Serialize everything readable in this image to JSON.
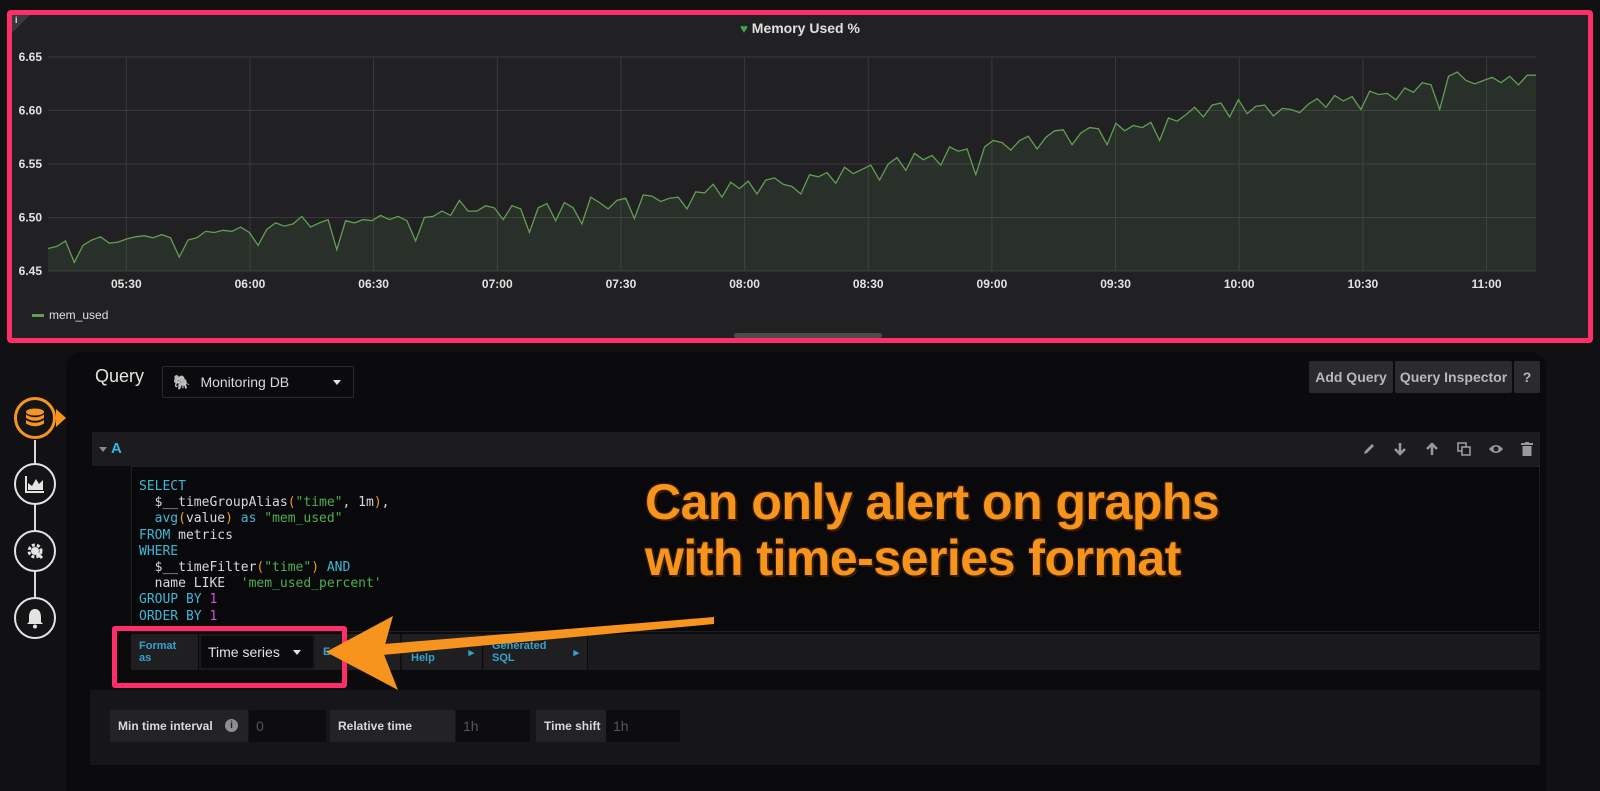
{
  "panel": {
    "title": "Memory Used %",
    "info_icon": "i",
    "legend_label": "mem_used",
    "series_color": "#629e51"
  },
  "chart_data": {
    "type": "area",
    "title": "Memory Used %",
    "xlabel": "",
    "ylabel": "",
    "ylim": [
      6.45,
      6.65
    ],
    "yticks": [
      "6.45",
      "6.50",
      "6.55",
      "6.60",
      "6.65"
    ],
    "xticks": [
      "05:30",
      "06:00",
      "06:30",
      "07:00",
      "07:30",
      "08:00",
      "08:30",
      "09:00",
      "09:30",
      "10:00",
      "10:30",
      "11:00"
    ],
    "xrange_minutes": [
      "05:11",
      "11:12"
    ],
    "grid": true,
    "legend": "bottom-left",
    "series": [
      {
        "name": "mem_used",
        "x_start": "05:11",
        "step_minutes": 2,
        "values": [
          6.471,
          6.473,
          6.478,
          6.458,
          6.474,
          6.479,
          6.482,
          6.476,
          6.477,
          6.48,
          6.482,
          6.483,
          6.481,
          6.484,
          6.481,
          6.463,
          6.479,
          6.481,
          6.487,
          6.486,
          6.488,
          6.487,
          6.491,
          6.486,
          6.474,
          6.489,
          6.495,
          6.492,
          6.494,
          6.501,
          6.491,
          6.495,
          6.498,
          6.47,
          6.497,
          6.495,
          6.498,
          6.497,
          6.502,
          6.498,
          6.501,
          6.497,
          6.478,
          6.5,
          6.501,
          6.506,
          6.502,
          6.516,
          6.506,
          6.506,
          6.511,
          6.509,
          6.498,
          6.511,
          6.508,
          6.486,
          6.509,
          6.513,
          6.497,
          6.514,
          6.509,
          6.494,
          6.519,
          6.514,
          6.508,
          6.516,
          6.518,
          6.499,
          6.521,
          6.52,
          6.515,
          6.518,
          6.519,
          6.508,
          6.524,
          6.523,
          6.531,
          6.519,
          6.533,
          6.527,
          6.534,
          6.522,
          6.535,
          6.537,
          6.531,
          6.529,
          6.522,
          6.54,
          6.538,
          6.542,
          6.532,
          6.547,
          6.541,
          6.545,
          6.549,
          6.535,
          6.55,
          6.556,
          6.544,
          6.56,
          6.554,
          6.558,
          6.549,
          6.566,
          6.562,
          6.564,
          6.54,
          6.566,
          6.572,
          6.57,
          6.563,
          6.572,
          6.576,
          6.564,
          6.575,
          6.581,
          6.582,
          6.568,
          6.579,
          6.584,
          6.583,
          6.568,
          6.588,
          6.581,
          6.586,
          6.584,
          6.589,
          6.572,
          6.593,
          6.59,
          6.596,
          6.603,
          6.594,
          6.605,
          6.607,
          6.594,
          6.61,
          6.597,
          6.604,
          6.605,
          6.595,
          6.602,
          6.601,
          6.598,
          6.606,
          6.611,
          6.603,
          6.614,
          6.609,
          6.613,
          6.601,
          6.618,
          6.615,
          6.616,
          6.61,
          6.621,
          6.617,
          6.626,
          6.624,
          6.601,
          6.632,
          6.636,
          6.628,
          6.625,
          6.628,
          6.631,
          6.626,
          6.632,
          6.624,
          6.633,
          6.633
        ]
      }
    ]
  },
  "sidebar": {
    "steps": [
      {
        "name": "queries",
        "icon": "database-icon",
        "active": true
      },
      {
        "name": "visualization",
        "icon": "area-chart-icon",
        "active": false
      },
      {
        "name": "general",
        "icon": "gear-wrench-icon",
        "active": false
      },
      {
        "name": "alert",
        "icon": "bell-icon",
        "active": false
      }
    ]
  },
  "query_editor": {
    "label": "Query",
    "datasource": "Monitoring DB",
    "datasource_icon": "postgres-elephant-icon",
    "buttons": {
      "add_query": "Add Query",
      "query_inspector": "Query Inspector",
      "help": "?"
    },
    "query": {
      "ref_id": "A",
      "row_actions": [
        "edit",
        "move-down",
        "move-up",
        "duplicate",
        "toggle-visibility",
        "delete"
      ],
      "sql_lines": [
        "SELECT",
        "  $__timeGroupAlias(\"time\", 1m),",
        "  avg(value) as \"mem_used\"",
        "FROM metrics",
        "WHERE",
        "  $__timeFilter(\"time\") AND",
        "  name LIKE  'mem_used_percent'",
        "GROUP BY 1",
        "ORDER BY 1"
      ],
      "format_as_label": "Format as",
      "format_as_value": "Time series",
      "edit_sql_label": "Edit SQL",
      "show_help_label": "Show Help",
      "generated_sql_label": "Generated SQL"
    },
    "options": {
      "min_time_interval_label": "Min time interval",
      "min_time_interval_placeholder": "0",
      "relative_time_label": "Relative time",
      "relative_time_placeholder": "1h",
      "time_shift_label": "Time shift",
      "time_shift_placeholder": "1h"
    }
  },
  "annotation": {
    "line1": "Can only alert on graphs",
    "line2": "with time-series format",
    "color": "#f7941e",
    "highlight_color": "#ff2d6a"
  }
}
